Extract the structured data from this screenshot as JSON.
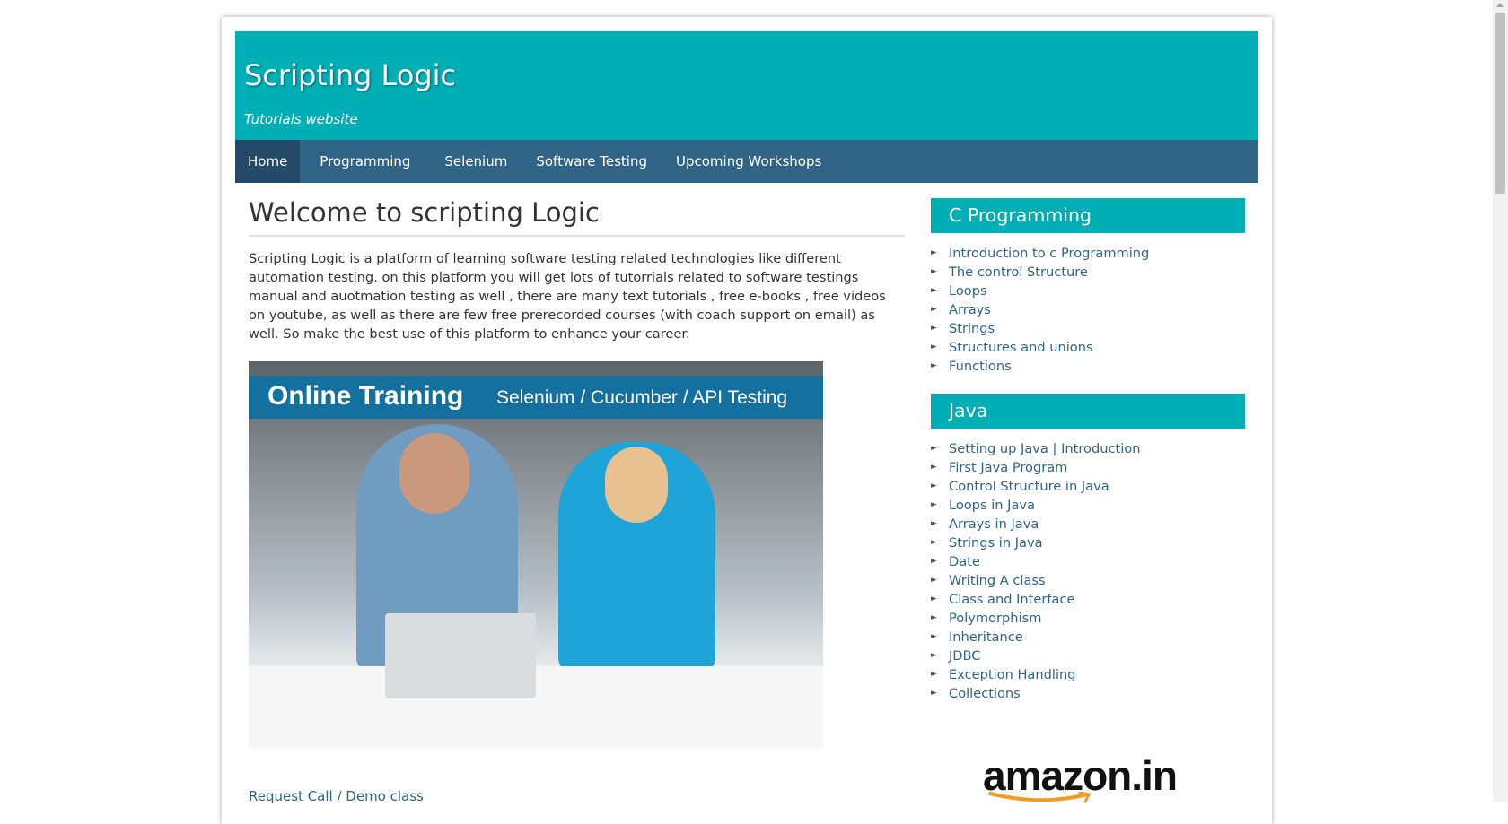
{
  "header": {
    "title": "Scripting Logic",
    "tagline": "Tutorials website"
  },
  "nav": {
    "items": [
      {
        "label": "Home",
        "active": true
      },
      {
        "label": "Programming",
        "active": false
      },
      {
        "label": "Selenium",
        "active": false
      },
      {
        "label": "Software Testing",
        "active": false
      },
      {
        "label": "Upcoming Workshops",
        "active": false
      }
    ]
  },
  "main": {
    "title": "Welcome to scripting Logic",
    "intro": "Scripting Logic is a platform of learning software testing related technologies like different automation testing. on this platform you will get lots of tutorrials related to software testings manual and auotmation testing as well , there are many text tutorials , free e-books , free videos on youtube, as well as there are few free prerecorded courses (with coach support on email) as well. So make the best use of this platform to enhance your career.",
    "banner": {
      "heading": "Online Training",
      "subheading": "Selenium / Cucumber / API Testing"
    },
    "request_link": "Request Call / Demo class"
  },
  "sidebar": {
    "widgets": [
      {
        "title": "C Programming",
        "items": [
          "Introduction to c Programming",
          "The control Structure",
          "Loops",
          "Arrays",
          "Strings",
          "Structures and unions",
          "Functions"
        ]
      },
      {
        "title": "Java",
        "items": [
          "Setting up Java | Introduction",
          "First Java Program",
          "Control Structure in Java",
          "Loops in Java",
          "Arrays in Java",
          "Strings in Java",
          "Date",
          "Writing A class",
          "Class and Interface",
          "Polymorphism",
          "Inheritance",
          "JDBC",
          "Exception Handling",
          "Collections"
        ]
      }
    ],
    "ad_logo": "amazon.in"
  },
  "colors": {
    "header_bg": "#00aeb6",
    "nav_bg": "#2f6486",
    "nav_active_bg": "#234b68",
    "link": "#2f6486",
    "banner_bar": "#14709f"
  },
  "icons": {
    "list_bullet": "triangle-right-icon"
  }
}
